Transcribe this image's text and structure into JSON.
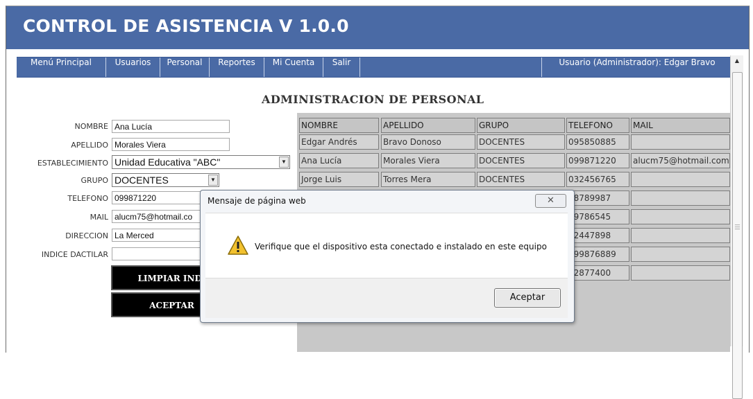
{
  "app": {
    "title": "CONTROL DE ASISTENCIA V 1.0.0"
  },
  "menu": {
    "items": [
      "Menú Principal",
      "Usuarios",
      "Personal",
      "Reportes",
      "Mi Cuenta",
      "Salir"
    ],
    "user_label": "Usuario (Administrador): Edgar Bravo"
  },
  "page": {
    "title": "ADMINISTRACION DE PERSONAL"
  },
  "form": {
    "nombre": {
      "label": "NOMBRE",
      "value": "Ana Lucía"
    },
    "apellido": {
      "label": "APELLIDO",
      "value": "Morales Viera"
    },
    "establecimiento": {
      "label": "ESTABLECIMIENTO",
      "value": "Unidad Educativa \"ABC\""
    },
    "grupo": {
      "label": "GRUPO",
      "value": "DOCENTES"
    },
    "telefono": {
      "label": "TELEFONO",
      "value": "099871220"
    },
    "mail": {
      "label": "MAIL",
      "value": "alucm75@hotmail.co"
    },
    "direccion": {
      "label": "DIRECCION",
      "value": "La Merced"
    },
    "indice": {
      "label": "INDICE DACTILAR",
      "value": ""
    },
    "limpiar_label": "LIMPIAR INDI",
    "aceptar_label": "ACEPTAR"
  },
  "table": {
    "headers": [
      "NOMBRE",
      "APELLIDO",
      "GRUPO",
      "TELEFONO",
      "MAIL"
    ],
    "rows": [
      [
        "Edgar Andrés",
        "Bravo Donoso",
        "DOCENTES",
        "095850885",
        ""
      ],
      [
        "Ana Lucía",
        "Morales Viera",
        "DOCENTES",
        "099871220",
        "alucm75@hotmail.com"
      ],
      [
        "Jorge Luis",
        "Torres Mera",
        "DOCENTES",
        "032456765",
        ""
      ],
      [
        "",
        "",
        "",
        "98789987",
        ""
      ],
      [
        "",
        "",
        "",
        "99786545",
        ""
      ],
      [
        "",
        "",
        "",
        "32447898",
        ""
      ],
      [
        "",
        "",
        "",
        "999876889",
        ""
      ],
      [
        "",
        "",
        "",
        "32877400",
        ""
      ]
    ]
  },
  "dialog": {
    "title": "Mensaje de página web",
    "message": "Verifique que el dispositivo esta conectado e instalado en este equipo",
    "ok_label": "Aceptar",
    "close_glyph": "✕",
    "icon": "warning-icon"
  },
  "colors": {
    "brand": "#4a6aa5",
    "grid": "#d4d4d4",
    "warning": "#f2c12e"
  }
}
